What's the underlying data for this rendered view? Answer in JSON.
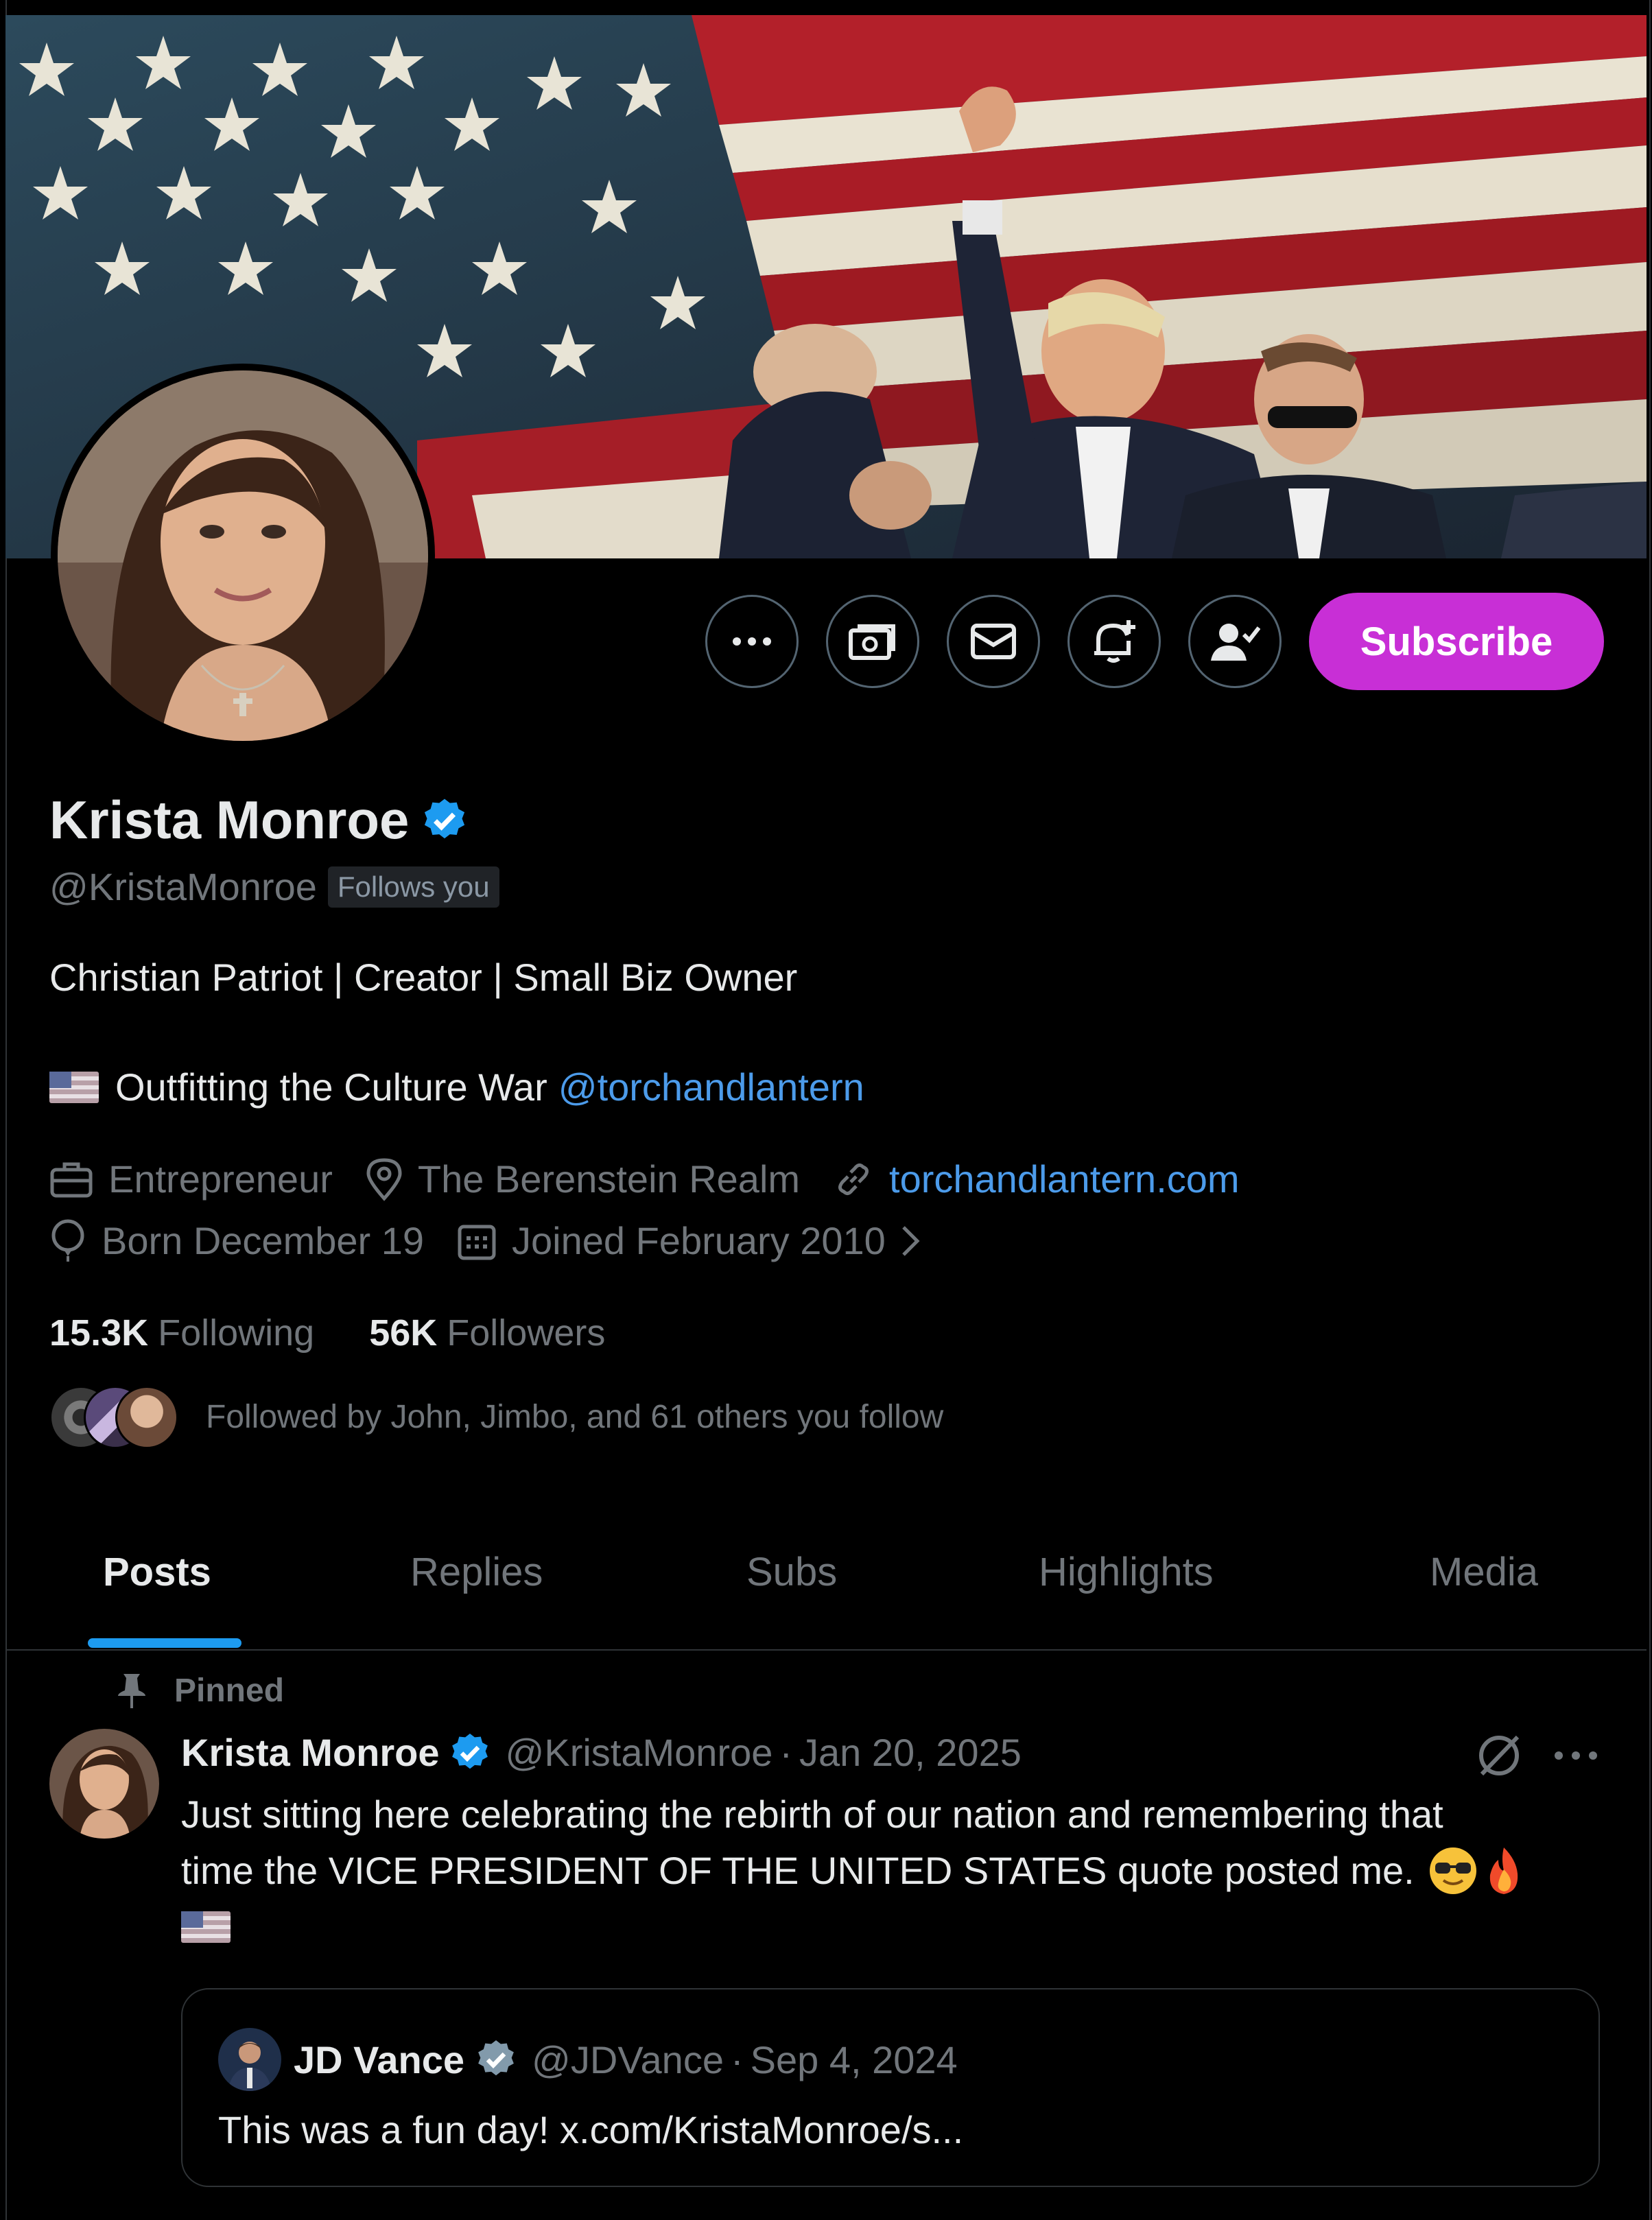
{
  "profile": {
    "name": "Krista Monroe",
    "handle": "@KristaMonroe",
    "follows_you_badge": "Follows you",
    "bio_line1": "Christian Patriot | Creator | Small Biz Owner",
    "bio_line2_text": "Outfitting the Culture War",
    "bio_line2_mention": "@torchandlantern",
    "profession": "Entrepreneur",
    "location": "The Berenstein Realm",
    "website": "torchandlantern.com",
    "birthday": "Born December 19",
    "joined": "Joined February 2010",
    "following_count": "15.3K",
    "following_label": "Following",
    "followers_count": "56K",
    "followers_label": "Followers",
    "followed_by": "Followed by John, Jimbo, and 61 others you follow"
  },
  "actions": {
    "more_icon": "more-icon",
    "tip_icon": "money-icon",
    "message_icon": "envelope-icon",
    "notify_icon": "bell-plus-icon",
    "following_icon": "person-check-icon",
    "subscribe_label": "Subscribe"
  },
  "tabs": [
    {
      "label": "Posts",
      "active": true
    },
    {
      "label": "Replies",
      "active": false
    },
    {
      "label": "Subs",
      "active": false
    },
    {
      "label": "Highlights",
      "active": false
    },
    {
      "label": "Media",
      "active": false
    }
  ],
  "pinned_post": {
    "pinned_label": "Pinned",
    "author_name": "Krista Monroe",
    "author_handle": "@KristaMonroe",
    "separator": "·",
    "date": "Jan 20, 2025",
    "text_line1": "Just sitting here celebrating the rebirth of our nation and remembering that",
    "text_line2": "time the VICE PRESIDENT OF THE UNITED STATES quote posted me.",
    "quote": {
      "author_name": "JD Vance",
      "author_handle": "@JDVance",
      "separator": "·",
      "date": "Sep 4, 2024",
      "text": "This was a fun day! x.com/KristaMonroe/s..."
    }
  },
  "colors": {
    "accent": "#1d9bf0",
    "subscribe": "#c82fd6",
    "link": "#4c9bea",
    "muted": "#71767b"
  }
}
